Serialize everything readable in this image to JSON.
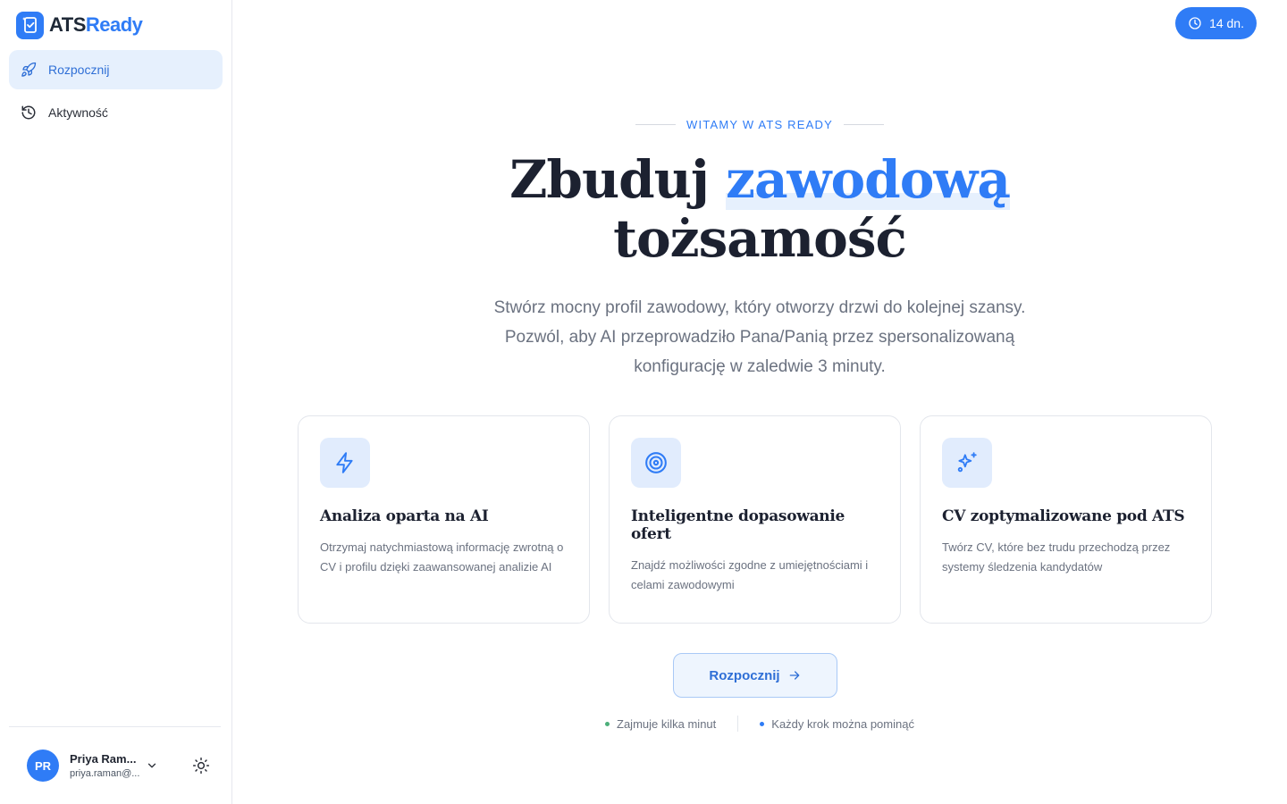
{
  "brand": {
    "ats": "ATS",
    "ready": "Ready",
    "accent_color": "#2f7cf6"
  },
  "sidebar": {
    "items": [
      {
        "label": "Rozpocznij",
        "icon": "rocket-icon",
        "active": true
      },
      {
        "label": "Aktywność",
        "icon": "history-icon",
        "active": false
      }
    ],
    "user": {
      "initials": "PR",
      "name": "Priya Ram...",
      "email": "priya.raman@..."
    }
  },
  "trial": {
    "label": "14 dn.",
    "icon": "clock-icon"
  },
  "hero": {
    "eyebrow": "WITAMY W ATS READY",
    "title_part1": "Zbuduj ",
    "title_accent": "zawodową",
    "title_part2": "tożsamość",
    "subtitle_lines": [
      "Stwórz mocny profil zawodowy, który otworzy drzwi do kolejnej szansy.",
      "Pozwól, aby AI przeprowadziło Pana/Panią przez spersonalizowaną",
      "konfigurację w zaledwie 3 minuty."
    ]
  },
  "features": [
    {
      "icon": "lightning-icon",
      "title": "Analiza oparta na AI",
      "description": "Otrzymaj natychmiastową informację zwrotną o CV i profilu dzięki zaawansowanej analizie AI"
    },
    {
      "icon": "target-icon",
      "title": "Inteligentne dopasowanie ofert",
      "description": "Znajdź możliwości zgodne z umiejętnościami i celami zawodowymi"
    },
    {
      "icon": "sparkles-icon",
      "title": "CV zoptymalizowane pod ATS",
      "description": "Twórz CV, które bez trudu przechodzą przez systemy śledzenia kandydatów"
    }
  ],
  "cta": {
    "label": "Rozpocznij",
    "icon": "arrow-right-icon"
  },
  "notes": [
    {
      "label": "Zajmuje kilka minut",
      "dot_color": "#4caf7a"
    },
    {
      "label": "Każdy krok można pominąć",
      "dot_color": "#2f7cf6"
    }
  ]
}
